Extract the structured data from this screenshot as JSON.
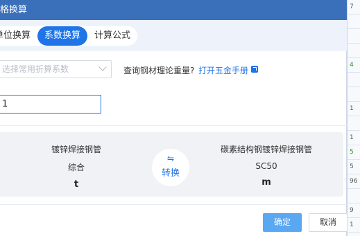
{
  "window": {
    "title": "格换算"
  },
  "tabs": [
    {
      "label": "单位换算",
      "active": false
    },
    {
      "label": "系数换算",
      "active": true
    },
    {
      "label": "计算公式",
      "active": false
    }
  ],
  "coefficient_select": {
    "placeholder": "选择常用折算系数"
  },
  "query": {
    "text": "查询钢材理论重量?",
    "link_label": "打开五金手册",
    "link_icon": "external-link-icon"
  },
  "value_input": {
    "value": "1"
  },
  "conversion": {
    "from": {
      "name": "镀锌焊接钢管",
      "spec": "综合",
      "unit": "t"
    },
    "to": {
      "name": "碳素结构钢镀锌焊接钢管",
      "spec": "SC50",
      "unit": "m"
    },
    "swap": {
      "symbol": "⇋",
      "label": "转换"
    }
  },
  "buttons": {
    "confirm": "确定",
    "cancel": "取消"
  },
  "background_sheet": {
    "cells": [
      "7",
      "",
      "",
      "",
      "4",
      "",
      "",
      "1",
      "",
      "1",
      "5",
      "5",
      "96",
      "",
      "9",
      "1",
      ""
    ]
  },
  "colors": {
    "title_bar": "#3a6fba",
    "accent": "#1f74e8",
    "confirm_button": "#5aa7f2"
  }
}
